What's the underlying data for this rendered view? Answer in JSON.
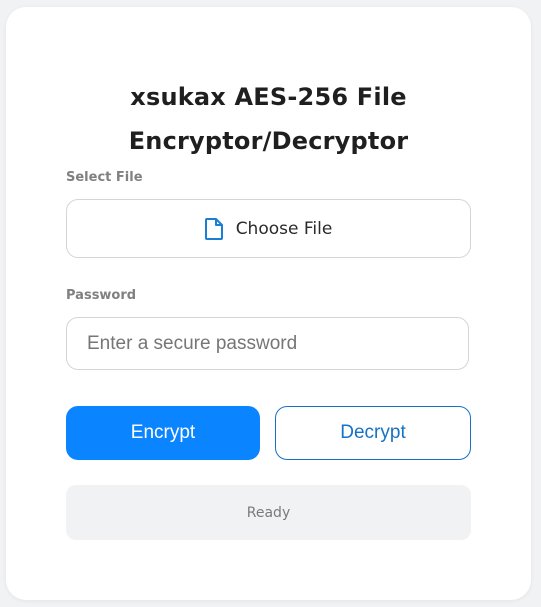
{
  "app": {
    "title": "xsukax AES-256 File Encryptor/Decryptor"
  },
  "file": {
    "label": "Select File",
    "button_label": "Choose File",
    "icon": "file-icon"
  },
  "password": {
    "label": "Password",
    "value": "",
    "placeholder": "Enter a secure password"
  },
  "actions": {
    "encrypt_label": "Encrypt",
    "decrypt_label": "Decrypt"
  },
  "status": {
    "text": "Ready"
  },
  "colors": {
    "accent": "#0a84ff",
    "decrypt_outline": "#1672c4",
    "background": "#f1f2f4",
    "card": "#ffffff"
  }
}
